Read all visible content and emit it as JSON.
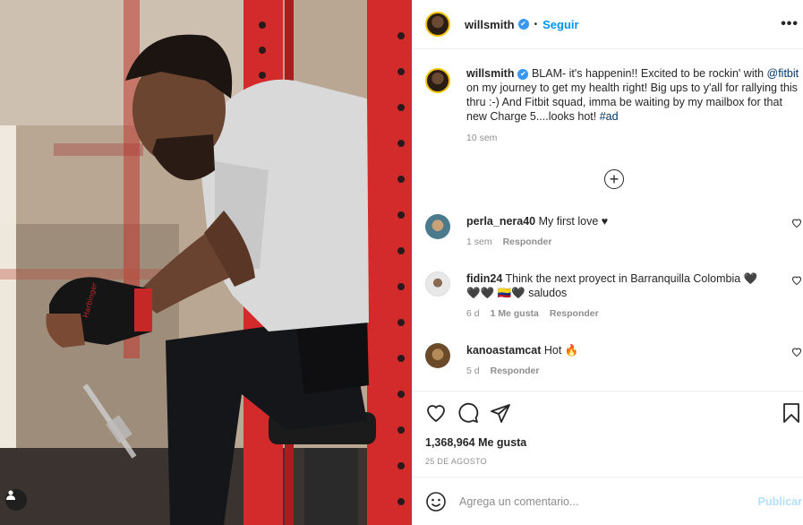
{
  "post": {
    "username": "willsmith",
    "follow_label": "Seguir",
    "separator": "•",
    "verified_icon": "✔",
    "more_label": "•••"
  },
  "caption": {
    "username": "willsmith",
    "text_before": " BLAM- it's happenin!! Excited to be rockin' with ",
    "mention": "@fitbit",
    "text_after": " on my journey to get my health right! Big ups to y'all for rallying this thru :-) And Fitbit squad, imma be waiting by my mailbox for that new Charge 5....looks hot! ",
    "hashtag": "#ad",
    "time": "10 sem"
  },
  "load_more_label": "+",
  "comments": [
    {
      "username": "perla_nera40",
      "text": "My first love ♥",
      "time": "1 sem",
      "likes": "",
      "reply": "Responder",
      "avatar_color": "#4a7a8c"
    },
    {
      "username": "fidin24",
      "text": "Think the next proyect in Barranquilla Colombia 🖤🖤🖤 🇨🇴🖤 saludos",
      "time": "6 d",
      "likes": "1 Me gusta",
      "reply": "Responder",
      "avatar_color": "#e8e8e8"
    },
    {
      "username": "kanoastamcat",
      "text": "Hot 🔥",
      "time": "5 d",
      "likes": "",
      "reply": "Responder",
      "avatar_color": "#6b4a2a"
    }
  ],
  "actions": {
    "likes_count": "1,368,964 Me gusta",
    "date": "25 DE AGOSTO"
  },
  "add_comment": {
    "placeholder": "Agrega un comentario...",
    "publish_label": "Publicar"
  },
  "colors": {
    "accent": "#0095f6",
    "publish_disabled": "#b2dffc",
    "muted": "#8e8e8e",
    "text": "#262626"
  }
}
